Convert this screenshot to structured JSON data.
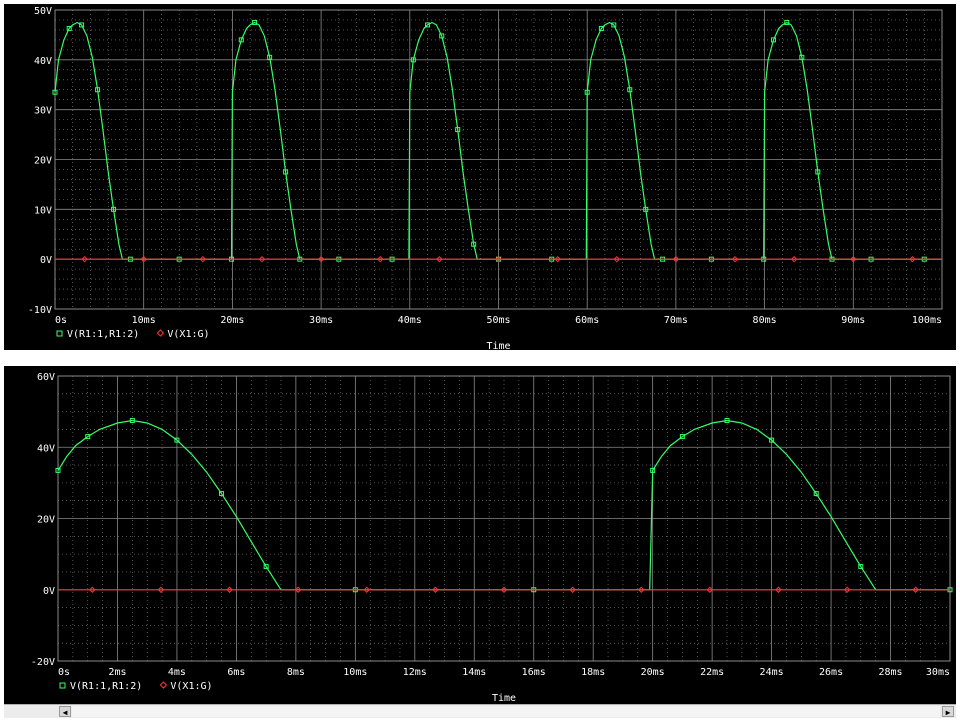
{
  "colors": {
    "background": "#000000",
    "grid": "#8a8a8a",
    "axis_text": "#ffffff",
    "series_green": "#33ff66",
    "series_red": "#ff3333"
  },
  "chart_data": [
    {
      "type": "line",
      "xlabel": "Time",
      "ylabel": "",
      "xlim": [
        0,
        100
      ],
      "ylim": [
        -10,
        50
      ],
      "x_unit": "ms",
      "xticks": [
        0,
        10,
        20,
        30,
        40,
        50,
        60,
        70,
        80,
        90,
        100
      ],
      "xtick_labels": [
        "0s",
        "10ms",
        "20ms",
        "30ms",
        "40ms",
        "50ms",
        "60ms",
        "70ms",
        "80ms",
        "90ms",
        "100ms"
      ],
      "yticks": [
        -10,
        0,
        10,
        20,
        30,
        40,
        50
      ],
      "ytick_labels": [
        "-10V",
        "0V",
        "10V",
        "20V",
        "30V",
        "40V",
        "50V"
      ],
      "grid": true,
      "legend_position": "bottom-left",
      "series": [
        {
          "name": "V(R1:1,R1:2)",
          "color": "#33ff66",
          "marker": "square",
          "x": [
            0,
            0.4,
            1.0,
            1.6,
            2.0,
            2.5,
            3.0,
            3.6,
            4.2,
            4.8,
            5.4,
            6.0,
            6.6,
            7.2,
            7.6,
            8.5,
            10,
            12,
            14,
            16,
            18,
            19.9,
            20.0,
            20.4,
            21.0,
            21.6,
            22.0,
            22.5,
            23.0,
            23.6,
            24.2,
            24.8,
            25.4,
            26.0,
            26.6,
            27.2,
            27.6,
            28.5,
            30,
            32,
            34,
            36,
            38,
            39.9,
            40.0,
            40.4,
            41.0,
            41.6,
            42.0,
            42.5,
            43.0,
            43.6,
            44.2,
            44.8,
            45.4,
            46.0,
            46.6,
            47.2,
            47.6,
            48.5,
            50,
            52,
            54,
            56,
            58,
            59.9,
            60.0,
            60.4,
            61.0,
            61.6,
            62.0,
            62.5,
            63.0,
            63.6,
            64.2,
            64.8,
            65.4,
            66.0,
            66.6,
            67.2,
            67.6,
            68.5,
            70,
            72,
            74,
            76,
            78,
            79.9,
            80.0,
            80.4,
            81.0,
            81.6,
            82.0,
            82.5,
            83.0,
            83.6,
            84.2,
            84.8,
            85.4,
            86.0,
            86.6,
            87.2,
            87.6,
            88.5,
            90,
            92,
            94,
            96,
            98,
            100
          ],
          "y": [
            33.5,
            40.0,
            44.0,
            46.3,
            47.0,
            47.5,
            47.0,
            44.8,
            40.5,
            34.0,
            26.0,
            17.5,
            10.0,
            3.0,
            0,
            0,
            0,
            0,
            0,
            0,
            0,
            0,
            33.5,
            40.0,
            44.0,
            46.3,
            47.0,
            47.5,
            47.0,
            44.8,
            40.5,
            34.0,
            26.0,
            17.5,
            10.0,
            3.0,
            0,
            0,
            0,
            0,
            0,
            0,
            0,
            0,
            33.5,
            40.0,
            44.0,
            46.3,
            47.0,
            47.5,
            47.0,
            44.8,
            40.5,
            34.0,
            26.0,
            17.5,
            10.0,
            3.0,
            0,
            0,
            0,
            0,
            0,
            0,
            0,
            0,
            33.5,
            40.0,
            44.0,
            46.3,
            47.0,
            47.5,
            47.0,
            44.8,
            40.5,
            34.0,
            26.0,
            17.5,
            10.0,
            3.0,
            0,
            0,
            0,
            0,
            0,
            0,
            0,
            0,
            33.5,
            40.0,
            44.0,
            46.3,
            47.0,
            47.5,
            47.0,
            44.8,
            40.5,
            34.0,
            26.0,
            17.5,
            10.0,
            3.0,
            0,
            0,
            0,
            0,
            0,
            0,
            0,
            0
          ]
        },
        {
          "name": "V(X1:G)",
          "color": "#ff3333",
          "marker": "diamond",
          "x": [
            0,
            100
          ],
          "y": [
            0,
            0
          ]
        }
      ]
    },
    {
      "type": "line",
      "xlabel": "Time",
      "ylabel": "",
      "xlim": [
        0,
        30
      ],
      "ylim": [
        -20,
        60
      ],
      "x_unit": "ms",
      "xticks": [
        0,
        2,
        4,
        6,
        8,
        10,
        12,
        14,
        16,
        18,
        20,
        22,
        24,
        26,
        28,
        30
      ],
      "xtick_labels": [
        "0s",
        "2ms",
        "4ms",
        "6ms",
        "8ms",
        "10ms",
        "12ms",
        "14ms",
        "16ms",
        "18ms",
        "20ms",
        "22ms",
        "24ms",
        "26ms",
        "28ms",
        "30ms"
      ],
      "yticks": [
        -20,
        0,
        20,
        40,
        60
      ],
      "ytick_labels": [
        "-20V",
        "0V",
        "20V",
        "40V",
        "60V"
      ],
      "grid": true,
      "legend_position": "bottom-left",
      "series": [
        {
          "name": "V(R1:1,R1:2)",
          "color": "#33ff66",
          "marker": "square",
          "x": [
            0,
            0.3,
            0.6,
            1.0,
            1.4,
            2.0,
            2.5,
            3.0,
            3.5,
            4.0,
            4.5,
            5.0,
            5.5,
            6.0,
            6.5,
            7.0,
            7.5,
            8,
            10,
            12,
            14,
            16,
            18,
            19.9,
            20.0,
            20.3,
            20.6,
            21.0,
            21.4,
            22.0,
            22.5,
            23.0,
            23.5,
            24.0,
            24.5,
            25.0,
            25.5,
            26.0,
            26.5,
            27.0,
            27.5,
            28,
            30
          ],
          "y": [
            33.5,
            37.5,
            40.5,
            43.0,
            45.0,
            46.8,
            47.5,
            46.8,
            45.0,
            42.0,
            38.0,
            33.0,
            27.0,
            20.5,
            13.5,
            6.5,
            0,
            0,
            0,
            0,
            0,
            0,
            0,
            0,
            33.5,
            37.5,
            40.5,
            43.0,
            45.0,
            46.8,
            47.5,
            46.8,
            45.0,
            42.0,
            38.0,
            33.0,
            27.0,
            20.5,
            13.5,
            6.5,
            0,
            0,
            0
          ]
        },
        {
          "name": "V(X1:G)",
          "color": "#ff3333",
          "marker": "diamond",
          "x": [
            0,
            30
          ],
          "y": [
            0,
            0
          ]
        }
      ]
    }
  ]
}
